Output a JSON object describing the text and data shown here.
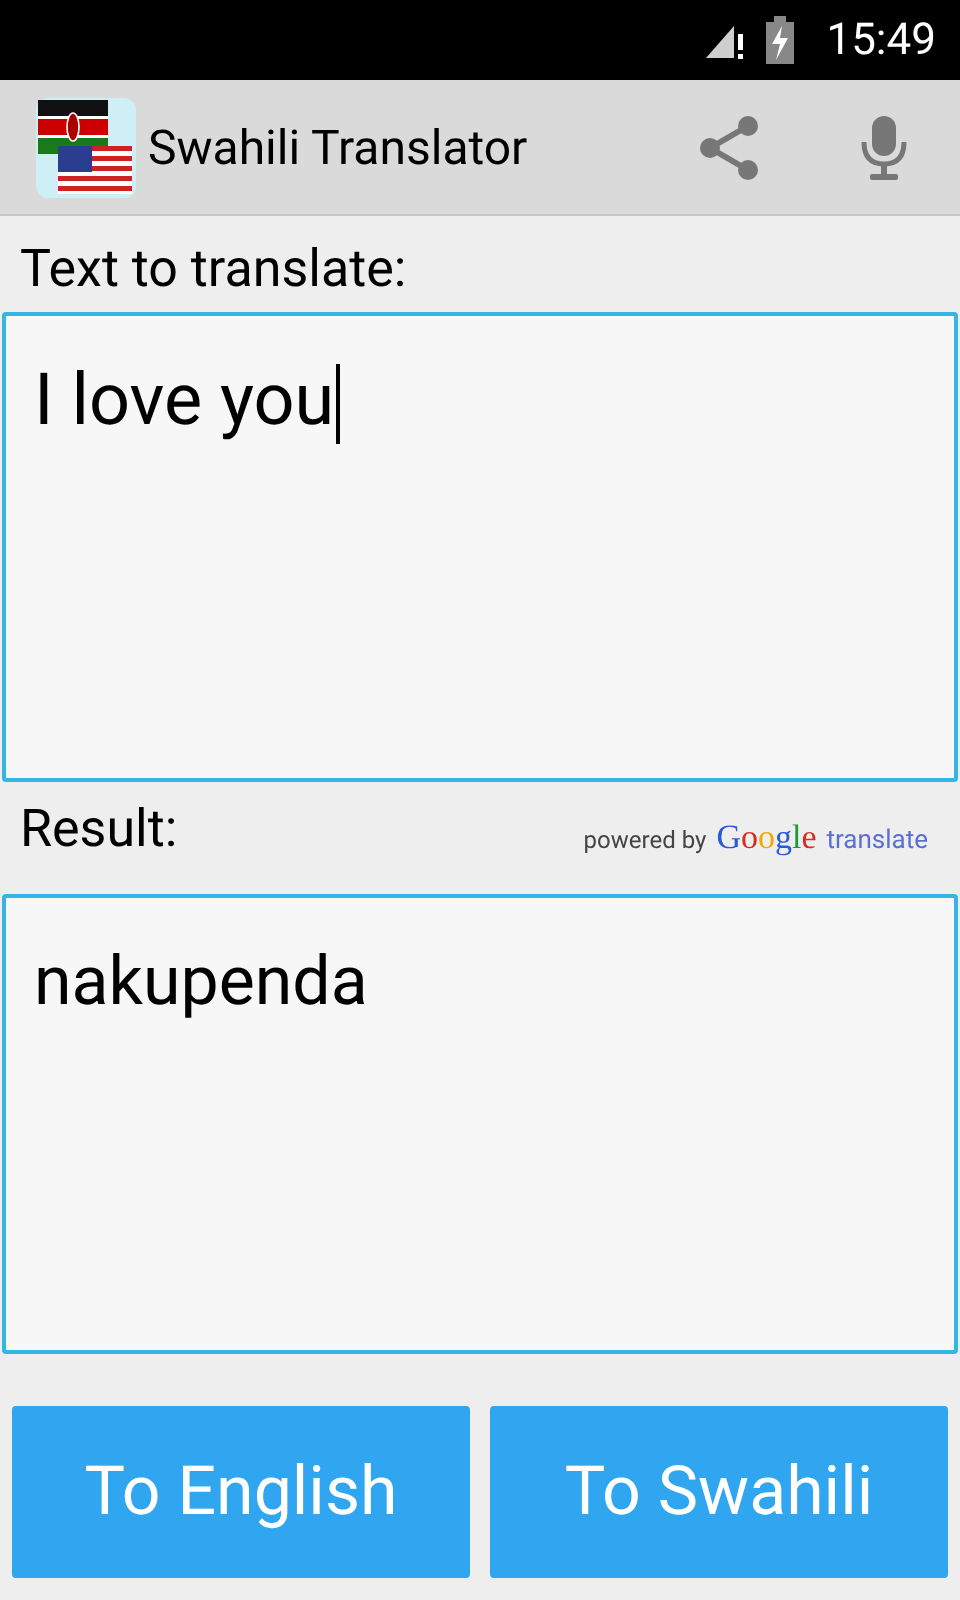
{
  "status_bar": {
    "time": "15:49"
  },
  "app_bar": {
    "title": "Swahili Translator"
  },
  "input": {
    "label": "Text to translate:",
    "value": "I love you",
    "focused": true
  },
  "result": {
    "label": "Result:",
    "value": "nakupenda",
    "powered_by": "powered by",
    "provider": "Google",
    "provider_suffix": "translate"
  },
  "buttons": [
    {
      "label": "To English"
    },
    {
      "label": "To Swahili"
    }
  ]
}
